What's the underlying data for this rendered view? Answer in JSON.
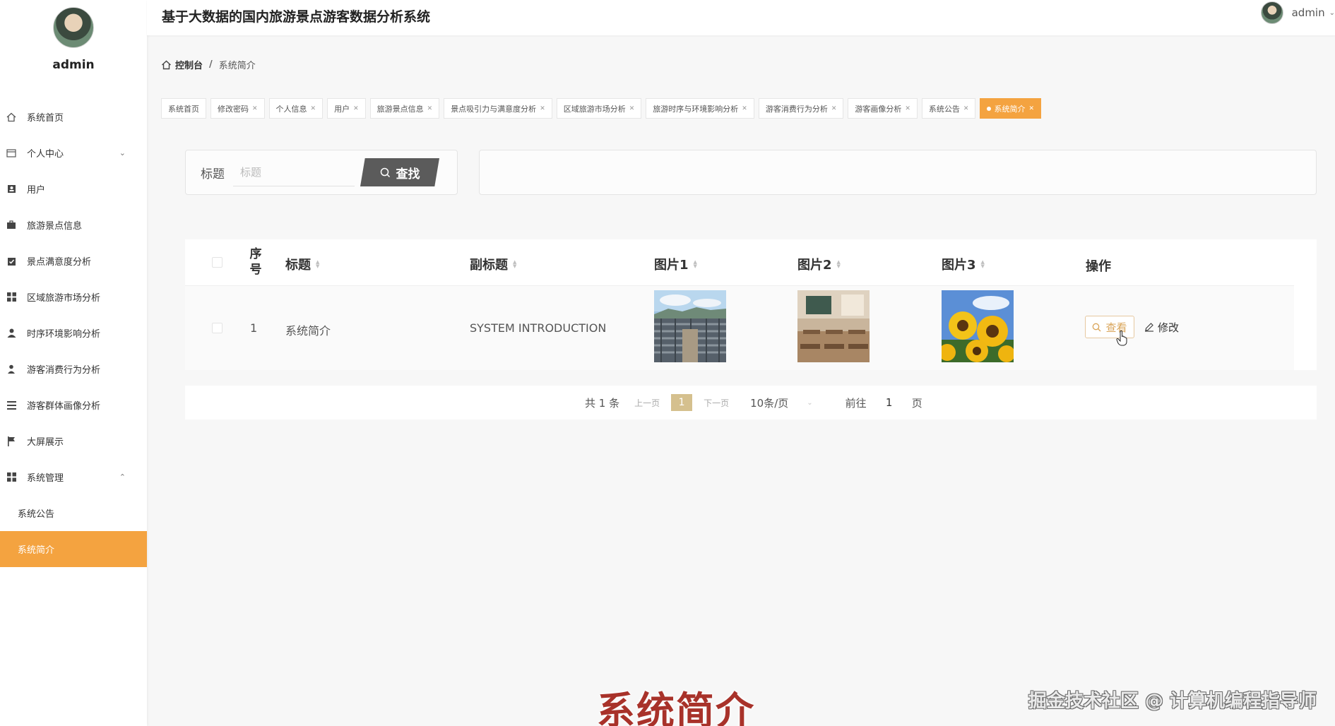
{
  "app": {
    "title": "基于大数据的国内旅游景点游客数据分析系统",
    "user_name": "admin"
  },
  "sidebar": {
    "profile_name": "admin",
    "items": [
      {
        "label": "系统首页",
        "icon": "home-icon"
      },
      {
        "label": "个人中心",
        "icon": "card-icon",
        "expandable": true
      },
      {
        "label": "用户",
        "icon": "user-box-icon"
      },
      {
        "label": "旅游景点信息",
        "icon": "briefcase-icon"
      },
      {
        "label": "景点满意度分析",
        "icon": "clipboard-check-icon"
      },
      {
        "label": "区域旅游市场分析",
        "icon": "grid-icon"
      },
      {
        "label": "时序环境影响分析",
        "icon": "person-icon"
      },
      {
        "label": "游客消费行为分析",
        "icon": "person-icon"
      },
      {
        "label": "游客群体画像分析",
        "icon": "list-icon"
      },
      {
        "label": "大屏展示",
        "icon": "flag-icon"
      },
      {
        "label": "系统管理",
        "icon": "grid-icon",
        "expanded": true
      }
    ],
    "sub_items": [
      {
        "label": "系统公告",
        "active": false
      },
      {
        "label": "系统简介",
        "active": true
      }
    ]
  },
  "breadcrumb": {
    "home": "控制台",
    "separator": "/",
    "current": "系统简介"
  },
  "tags": [
    {
      "label": "系统首页",
      "closable": false,
      "active": false
    },
    {
      "label": "修改密码",
      "closable": true,
      "active": false
    },
    {
      "label": "个人信息",
      "closable": true,
      "active": false
    },
    {
      "label": "用户",
      "closable": true,
      "active": false
    },
    {
      "label": "旅游景点信息",
      "closable": true,
      "active": false
    },
    {
      "label": "景点吸引力与满意度分析",
      "closable": true,
      "active": false
    },
    {
      "label": "区域旅游市场分析",
      "closable": true,
      "active": false
    },
    {
      "label": "旅游时序与环境影响分析",
      "closable": true,
      "active": false
    },
    {
      "label": "游客消费行为分析",
      "closable": true,
      "active": false
    },
    {
      "label": "游客画像分析",
      "closable": true,
      "active": false
    },
    {
      "label": "系统公告",
      "closable": true,
      "active": false
    },
    {
      "label": "系统简介",
      "closable": true,
      "active": true
    }
  ],
  "search": {
    "label": "标题",
    "placeholder": "标题",
    "value": "",
    "button_label": "查找"
  },
  "table": {
    "headers": {
      "index": "序号",
      "title": "标题",
      "subtitle": "副标题",
      "image1": "图片1",
      "image2": "图片2",
      "image3": "图片3",
      "actions": "操作"
    },
    "rows": [
      {
        "index": "1",
        "title": "系统简介",
        "subtitle": "SYSTEM INTRODUCTION",
        "image1": "town-rooftops-photo",
        "image2": "classroom-photo",
        "image3": "sunflowers-photo"
      }
    ],
    "view_label": "查看",
    "edit_label": "修改"
  },
  "pagination": {
    "total": "共 1 条",
    "prev": "上一页",
    "page": "1",
    "next": "下一页",
    "page_size": "10条/页",
    "goto_prefix": "前往",
    "goto_value": "1",
    "goto_suffix": "页"
  },
  "overlay": {
    "caption": "系统简介",
    "watermark": "掘金技术社区 @ 计算机编程指导师"
  },
  "colors": {
    "accent": "#f4a340",
    "search_button": "#5b5b5b",
    "current_page": "#d5c08e",
    "caption": "#a8322a"
  }
}
